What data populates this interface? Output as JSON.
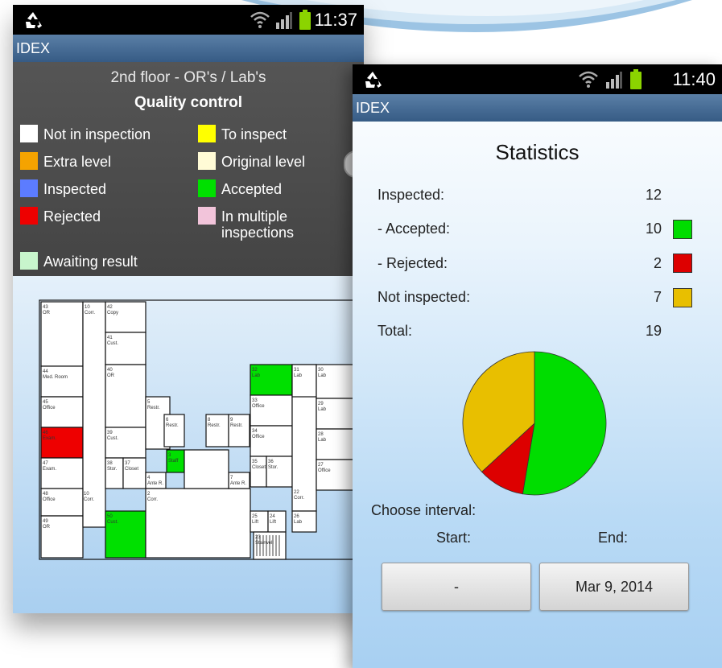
{
  "colors": {
    "accepted": "#00dd00",
    "rejected": "#dd0000",
    "not_inspected": "#e8bf00",
    "title_bar": "#3e638d"
  },
  "phone_left": {
    "status": {
      "time": "11:37",
      "icons": [
        "recycle-icon",
        "wifi-icon",
        "signal-icon",
        "battery-icon"
      ]
    },
    "app_title": "IDEX",
    "floor_title": "2nd floor - OR's / Lab's",
    "section_title": "Quality control",
    "legend": [
      {
        "label": "Not in inspection",
        "color": "#ffffff"
      },
      {
        "label": "To inspect",
        "color": "#ffff00"
      },
      {
        "label": "Extra level",
        "color": "#f5a300"
      },
      {
        "label": "Original level",
        "color": "#fffbd6"
      },
      {
        "label": "Inspected",
        "color": "#5c7cff"
      },
      {
        "label": "Accepted",
        "color": "#00e000"
      },
      {
        "label": "Rejected",
        "color": "#ee0000"
      },
      {
        "label": "In multiple inspections",
        "color": "#f2c4da"
      },
      {
        "label": "Awaiting result",
        "color": "#c8f5cc"
      }
    ],
    "rooms": {
      "r43": [
        "43",
        "OR"
      ],
      "r42": [
        "42",
        "Copy"
      ],
      "r41": [
        "41",
        "Cust."
      ],
      "r44": [
        "44",
        "Med. Room"
      ],
      "r40": [
        "40",
        "OR"
      ],
      "r45": [
        "45",
        "Office"
      ],
      "r46": [
        "46",
        "Exam."
      ],
      "r39": [
        "39",
        "Cust."
      ],
      "r47": [
        "47",
        "Exam."
      ],
      "r38": [
        "38",
        "Stor."
      ],
      "r37": [
        "37",
        "Closet"
      ],
      "r48": [
        "48",
        "Office"
      ],
      "r10": [
        "10",
        "Corr."
      ],
      "r49": [
        "49",
        "OR"
      ],
      "r50": [
        "50",
        "Cust."
      ],
      "r5": [
        "5",
        "Restr."
      ],
      "r6": [
        "6",
        "Restr."
      ],
      "r8": [
        "8",
        "Restr."
      ],
      "r9": [
        "9",
        "Restr."
      ],
      "r3": [
        "3",
        "Staff"
      ],
      "r4": [
        "4",
        "Ante R."
      ],
      "r7": [
        "7",
        "Ante R."
      ],
      "r2": [
        "2",
        "Corr."
      ],
      "r32": [
        "32",
        "Lab"
      ],
      "r31": [
        "31",
        "Lab"
      ],
      "r30": [
        "30",
        "Lab"
      ],
      "r33": [
        "33",
        "Office"
      ],
      "r29": [
        "29",
        "Lab"
      ],
      "r34": [
        "34",
        "Office"
      ],
      "r28": [
        "28",
        "Lab"
      ],
      "r35": [
        "35",
        "Closet"
      ],
      "r36": [
        "36",
        "Stor."
      ],
      "r27": [
        "27",
        "Office"
      ],
      "r22": [
        "22",
        "Corr."
      ],
      "r25": [
        "25",
        "Lift"
      ],
      "r24": [
        "24",
        "Lift"
      ],
      "r26": [
        "26",
        "Lab"
      ],
      "r23": [
        "23",
        "Stairwell"
      ]
    }
  },
  "phone_right": {
    "status": {
      "time": "11:40",
      "icons": [
        "recycle-icon",
        "wifi-icon",
        "signal-icon",
        "battery-icon"
      ]
    },
    "app_title": "IDEX",
    "stats_title": "Statistics",
    "rows": [
      {
        "label": "Inspected:",
        "value": "12",
        "color": null
      },
      {
        "label": "- Accepted:",
        "value": "10",
        "color": "#00dd00"
      },
      {
        "label": "- Rejected:",
        "value": "2",
        "color": "#dd0000"
      },
      {
        "label": "Not inspected:",
        "value": "7",
        "color": "#e8bf00"
      },
      {
        "label": "Total:",
        "value": "19",
        "color": null
      }
    ],
    "choose_interval": "Choose interval:",
    "start_label": "Start:",
    "end_label": "End:",
    "start_value": "-",
    "end_value": "Mar 9, 2014"
  },
  "chart_data": {
    "type": "pie",
    "categories": [
      "Accepted",
      "Rejected",
      "Not inspected"
    ],
    "values": [
      10,
      2,
      7
    ],
    "colors": [
      "#00dd00",
      "#dd0000",
      "#e8bf00"
    ]
  }
}
